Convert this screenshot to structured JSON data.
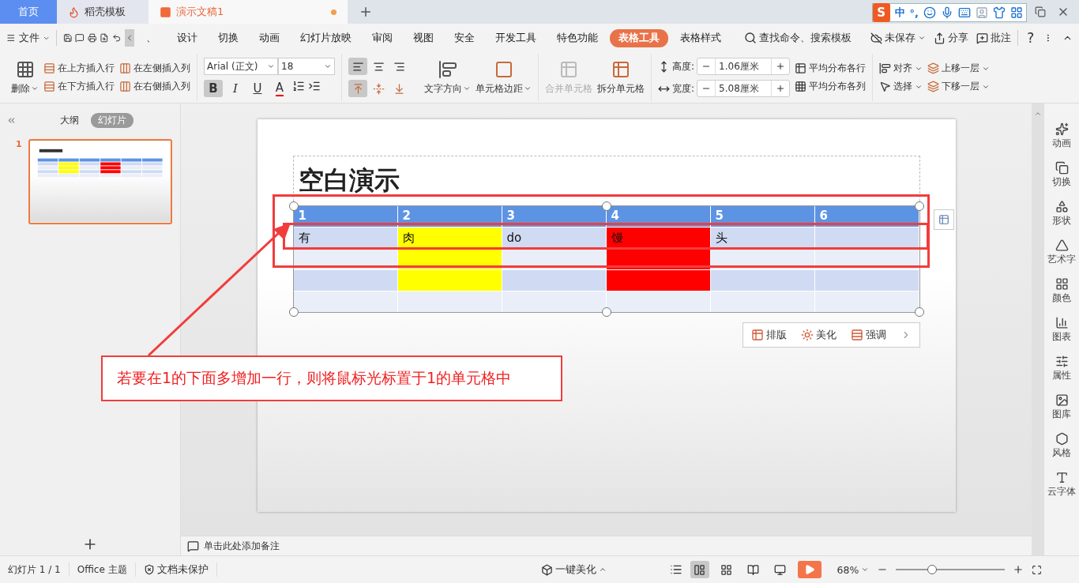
{
  "tabs": [
    {
      "label": "首页",
      "kind": "home",
      "selected": false
    },
    {
      "label": "稻壳模板",
      "kind": "docer",
      "selected": false
    },
    {
      "label": "演示文稿1",
      "kind": "doc",
      "selected": true
    }
  ],
  "ime": {
    "logo": "S",
    "mode": "中",
    "punct": "°,"
  },
  "menu": {
    "file": "文件",
    "tabs": [
      {
        "label": "、",
        "selected": false
      },
      {
        "label": "设计",
        "selected": false
      },
      {
        "label": "切换",
        "selected": false
      },
      {
        "label": "动画",
        "selected": false
      },
      {
        "label": "幻灯片放映",
        "selected": false
      },
      {
        "label": "审阅",
        "selected": false
      },
      {
        "label": "视图",
        "selected": false
      },
      {
        "label": "安全",
        "selected": false
      },
      {
        "label": "开发工具",
        "selected": false
      },
      {
        "label": "特色功能",
        "selected": false
      },
      {
        "label": "表格工具",
        "selected": true
      },
      {
        "label": "表格样式",
        "selected": false
      }
    ],
    "search": "查找命令、搜索模板",
    "save_status": "未保存",
    "share": "分享",
    "comment": "批注",
    "help": "?"
  },
  "ribbon": {
    "delete": "删除",
    "insert": [
      "在上方插入行",
      "在下方插入行",
      "在左侧插入列",
      "在右侧插入列"
    ],
    "font": "Arial (正文)",
    "size": "18",
    "format": [
      {
        "label": "B",
        "kind": "bold",
        "pressed": true
      },
      {
        "label": "I",
        "kind": "italic",
        "pressed": false
      },
      {
        "label": "U",
        "kind": "underline",
        "pressed": false
      },
      {
        "label": "A",
        "kind": "color",
        "pressed": false
      }
    ],
    "h_align": [
      {
        "kind": "left",
        "selected": true
      },
      {
        "kind": "center",
        "selected": false
      },
      {
        "kind": "right",
        "selected": false
      }
    ],
    "v_align": [
      {
        "kind": "top",
        "selected": true
      },
      {
        "kind": "middle",
        "selected": false
      },
      {
        "kind": "bottom",
        "selected": false
      }
    ],
    "text_direction": "文字方向",
    "cell_margin": "单元格边距",
    "merge": {
      "label": "合并单元格",
      "disabled": true
    },
    "split": {
      "label": "拆分单元格",
      "disabled": false
    },
    "height": {
      "label": "高度:",
      "value": "1.06厘米"
    },
    "width": {
      "label": "宽度:",
      "value": "5.08厘米"
    },
    "distribute_rows": "平均分布各行",
    "distribute_cols": "平均分布各列",
    "align": "对齐",
    "select": "选择",
    "bring_forward": "上移一层",
    "send_backward": "下移一层"
  },
  "panel_tabs": [
    {
      "label": "大纲",
      "selected": false
    },
    {
      "label": "幻灯片",
      "selected": true
    }
  ],
  "thumbnails": [
    {
      "number": "1",
      "selected": true
    }
  ],
  "slide": {
    "title": "空白演示",
    "table": {
      "header": [
        "1",
        "2",
        "3",
        "4",
        "5",
        "6"
      ],
      "rows": [
        [
          {
            "text": "有",
            "color": "#d0daf2"
          },
          {
            "text": "肉",
            "color": "#ffff00"
          },
          {
            "text": "do",
            "color": "#d0daf2"
          },
          {
            "text": "馒",
            "color": "#ff0000"
          },
          {
            "text": "头",
            "color": "#d0daf2"
          },
          {
            "color": "#d0daf2"
          }
        ],
        [
          {
            "color": "#e9eef8"
          },
          {
            "color": "#ffff00"
          },
          {
            "color": "#e9eef8"
          },
          {
            "color": "#ff0000"
          },
          {
            "color": "#e9eef8"
          },
          {
            "color": "#e9eef8"
          }
        ],
        [
          {
            "color": "#d0daf2"
          },
          {
            "color": "#ffff00"
          },
          {
            "color": "#d0daf2"
          },
          {
            "color": "#ff0000"
          },
          {
            "color": "#d0daf2"
          },
          {
            "color": "#d0daf2"
          }
        ],
        [
          {
            "color": "#e9eef8"
          },
          {
            "color": "#e9eef8"
          },
          {
            "color": "#e9eef8"
          },
          {
            "color": "#e9eef8"
          },
          {
            "color": "#e9eef8"
          },
          {
            "color": "#e9eef8"
          }
        ]
      ]
    }
  },
  "smart_tools": [
    {
      "label": "排版",
      "kind": "layout"
    },
    {
      "label": "美化",
      "kind": "beautify"
    },
    {
      "label": "强调",
      "kind": "emphasis"
    }
  ],
  "notes": "单击此处添加备注",
  "side_panel": [
    {
      "label": "动画",
      "kind": "animation"
    },
    {
      "label": "切换",
      "kind": "transition"
    },
    {
      "label": "形状",
      "kind": "shape"
    },
    {
      "label": "艺术字",
      "kind": "wordart"
    },
    {
      "label": "颜色",
      "kind": "color"
    },
    {
      "label": "图表",
      "kind": "chart"
    },
    {
      "label": "属性",
      "kind": "property"
    },
    {
      "label": "图库",
      "kind": "gallery"
    },
    {
      "label": "风格",
      "kind": "style"
    },
    {
      "label": "云字体",
      "kind": "font"
    }
  ],
  "status": {
    "slide": "幻灯片 1 / 1",
    "theme": "Office 主题",
    "protection": "文档未保护",
    "beautify": "一键美化",
    "views": [
      {
        "kind": "normal",
        "selected": true
      },
      {
        "kind": "sorter",
        "selected": false
      },
      {
        "kind": "reading",
        "selected": false
      },
      {
        "kind": "presenter",
        "selected": false
      }
    ],
    "zoom": "68%",
    "zoom_slider": {
      "level": 0.33
    }
  },
  "annotation": {
    "text": "若要在1的下面多增加一行，则将鼠标光标置于1的单元格中"
  }
}
